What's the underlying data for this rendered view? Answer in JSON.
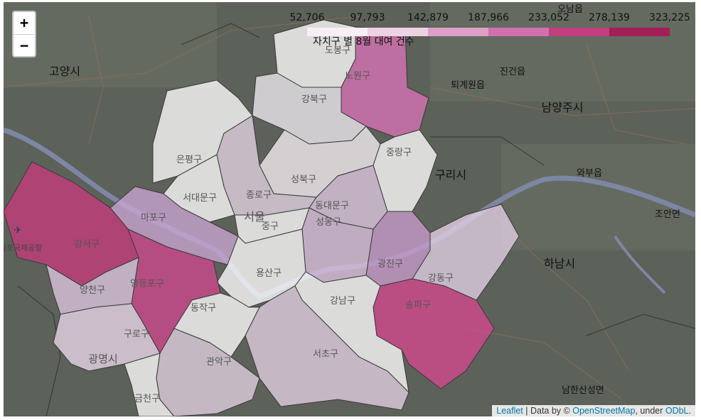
{
  "zoom": {
    "in_label": "+",
    "out_label": "−"
  },
  "legend": {
    "ticks": [
      "52,706",
      "97,793",
      "142,879",
      "187,966",
      "233,052",
      "278,139",
      "323,225"
    ],
    "caption": "자치구 별 8월 대여 건수",
    "colors": [
      "#f7eff4",
      "#ecd2e3",
      "#dda0c8",
      "#d070ad",
      "#c2407f",
      "#a31e56"
    ]
  },
  "attribution": {
    "leaflet": "Leaflet",
    "sep1": " | Data by © ",
    "osm": "OpenStreetMap",
    "sep2": ", under ",
    "odbl": "ODbL",
    "end": "."
  },
  "districts": [
    {
      "name": "도봉구",
      "fill": "#ffffff"
    },
    {
      "name": "노원구",
      "fill": "#d773b5"
    },
    {
      "name": "강북구",
      "fill": "#f0ebf1"
    },
    {
      "name": "은평구",
      "fill": "#ffffff"
    },
    {
      "name": "성북구",
      "fill": "#f6eef4"
    },
    {
      "name": "중랑구",
      "fill": "#ffffff"
    },
    {
      "name": "서대문구",
      "fill": "#ffffff"
    },
    {
      "name": "종로구",
      "fill": "#e4d3e4"
    },
    {
      "name": "동대문구",
      "fill": "#dfc8e0"
    },
    {
      "name": "마포구",
      "fill": "#cba5d2"
    },
    {
      "name": "중구",
      "fill": "#ffffff"
    },
    {
      "name": "성동구",
      "fill": "#dcc2df"
    },
    {
      "name": "광진구",
      "fill": "#c89ccc"
    },
    {
      "name": "강동구",
      "fill": "#e3d1e6"
    },
    {
      "name": "강서구",
      "fill": "#c73b7b"
    },
    {
      "name": "용산구",
      "fill": "#ffffff"
    },
    {
      "name": "영등포구",
      "fill": "#d0488e"
    },
    {
      "name": "양천구",
      "fill": "#ddc7e0"
    },
    {
      "name": "동작구",
      "fill": "#ffffff"
    },
    {
      "name": "구로구",
      "fill": "#ead9ea"
    },
    {
      "name": "금천구",
      "fill": "#ffffff"
    },
    {
      "name": "관악구",
      "fill": "#e2d2e2"
    },
    {
      "name": "서초구",
      "fill": "#e4d0e4"
    },
    {
      "name": "강남구",
      "fill": "#ffffff"
    },
    {
      "name": "송파구",
      "fill": "#d5498f"
    }
  ],
  "basemap_labels": {
    "goyang": "고양시",
    "guri": "구리시",
    "namyangju": "남양주시",
    "hanam": "하남시",
    "gwangmyeong": "광명시",
    "seoul": "서울",
    "jinjeon": "진건읍",
    "toegyewon": "퇴계원읍",
    "wabu": "와부읍",
    "joan": "조안면",
    "namhansanseong": "남한산성면",
    "oenam": "오남읍",
    "airport": "김포국제공항"
  }
}
